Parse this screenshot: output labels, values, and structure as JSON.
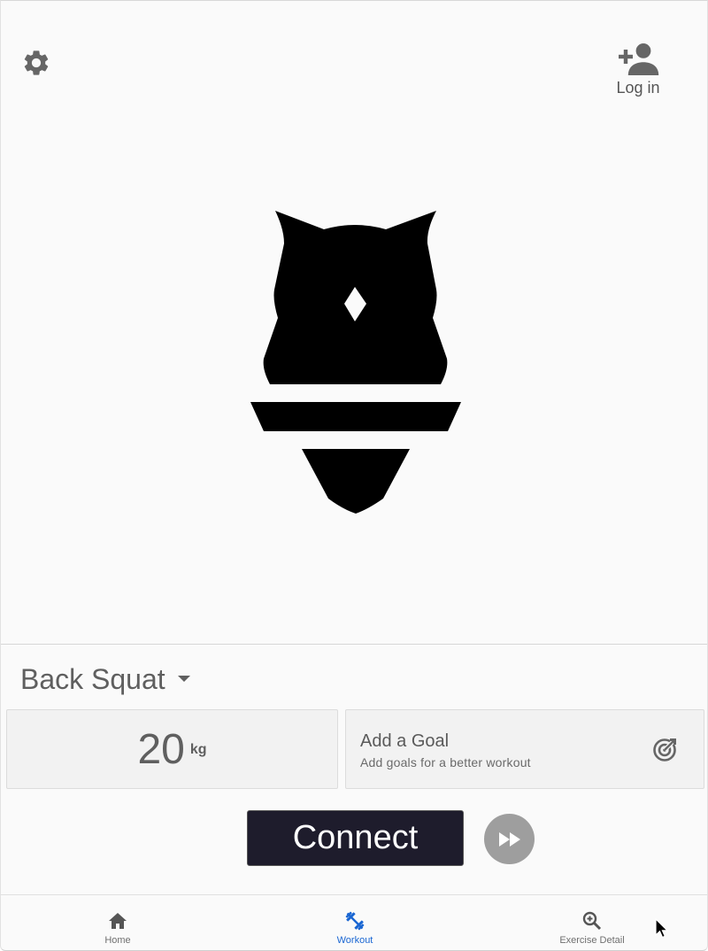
{
  "header": {
    "settings_icon": "gear-icon",
    "login_icon": "person-add-icon",
    "login_label": "Log in"
  },
  "logo": {
    "icon": "owl-logo"
  },
  "exercise": {
    "name": "Back Squat",
    "caret_icon": "caret-down-icon"
  },
  "weight": {
    "value": "20",
    "unit": "kg"
  },
  "goal": {
    "title": "Add a Goal",
    "subtitle": "Add goals for a better workout",
    "icon": "target-icon"
  },
  "actions": {
    "connect_label": "Connect",
    "skip_icon": "fast-forward-icon"
  },
  "nav": {
    "items": [
      {
        "label": "Home",
        "icon": "home-icon",
        "active": false
      },
      {
        "label": "Workout",
        "icon": "dumbbell-icon",
        "active": true
      },
      {
        "label": "Exercise Detail",
        "icon": "zoom-in-icon",
        "active": false
      }
    ]
  },
  "colors": {
    "background": "#fafafa",
    "connect_bg": "#1e1c2c",
    "nav_active": "#1a66d2",
    "icon_gray": "#666666",
    "skip_bg": "#9e9e9e"
  }
}
